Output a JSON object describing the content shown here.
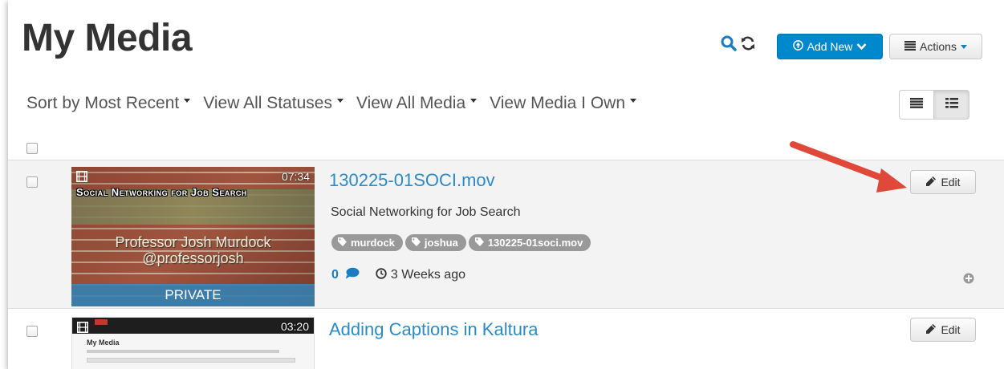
{
  "header": {
    "title": "My Media",
    "add_new_label": "Add New",
    "actions_label": "Actions"
  },
  "filters": [
    {
      "label": "Sort by Most Recent"
    },
    {
      "label": "View All Statuses"
    },
    {
      "label": "View All Media"
    },
    {
      "label": "View Media I Own"
    }
  ],
  "colors": {
    "accent": "#0088cc",
    "link": "#2a8bc8",
    "tag_bg": "#999999",
    "annotation_arrow": "#e0483a"
  },
  "media": [
    {
      "title": "130225-01SOCI.mov",
      "description": "Social Networking for Job Search",
      "tags": [
        "murdock",
        "joshua",
        "130225-01soci.mov"
      ],
      "duration": "07:34",
      "status": "PRIVATE",
      "comments": "0",
      "date": "3 Weeks ago",
      "edit_label": "Edit",
      "thumb_title": "Social Networking for Job Search",
      "thumb_line1": "Professor Josh Murdock",
      "thumb_line2": "@professorjosh"
    },
    {
      "title": "Adding Captions in Kaltura",
      "duration": "03:20",
      "edit_label": "Edit",
      "thumb_title": "My Media"
    }
  ],
  "icons": [
    "search-icon",
    "refresh-icon",
    "upload-icon",
    "chevron-down-icon",
    "list-icon",
    "detailed-list-icon",
    "film-icon",
    "tag-icon",
    "comment-icon",
    "clock-icon",
    "pencil-icon",
    "plus-circle-icon"
  ]
}
